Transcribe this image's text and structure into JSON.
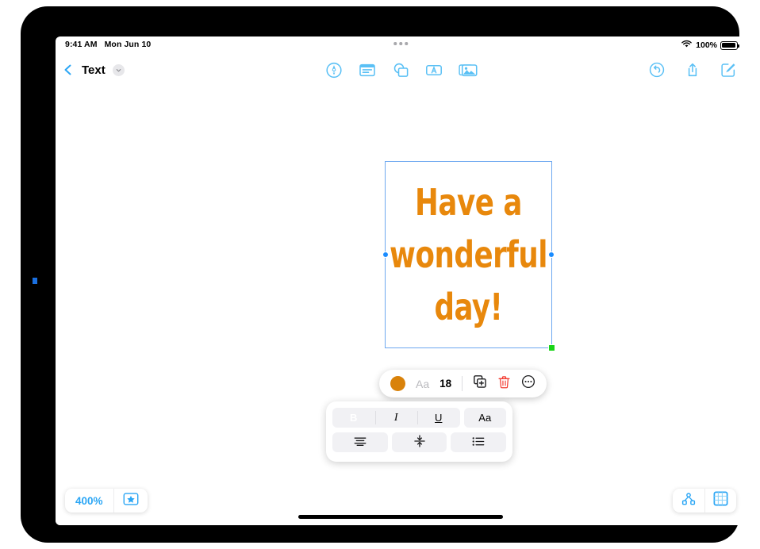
{
  "status_bar": {
    "time": "9:41 AM",
    "date": "Mon Jun 10",
    "battery_percent": "100%",
    "wifi_icon": "wifi-icon",
    "battery_icon": "battery-icon",
    "multitask_icon": "multitasking-dots-icon"
  },
  "nav_bar": {
    "back_icon": "chevron-left-icon",
    "document_title": "Text",
    "title_chevron_icon": "chevron-down-icon",
    "center_tools": [
      {
        "name": "markup-pen-tool",
        "icon": "pen-circle-icon"
      },
      {
        "name": "text-box-tool",
        "icon": "text-document-icon"
      },
      {
        "name": "shapes-tool",
        "icon": "overlapping-shapes-icon"
      },
      {
        "name": "insert-text-tool",
        "icon": "letter-a-box-icon"
      },
      {
        "name": "media-tool",
        "icon": "photo-stack-icon"
      }
    ],
    "right_tools": [
      {
        "name": "undo-button",
        "icon": "undo-circle-icon"
      },
      {
        "name": "share-button",
        "icon": "share-up-arrow-icon"
      },
      {
        "name": "compose-button",
        "icon": "compose-pencil-square-icon"
      }
    ]
  },
  "canvas": {
    "selected_text": {
      "lines": [
        "Have a",
        "wonderful",
        "day!"
      ],
      "color": "#e8880c",
      "selection_border_color": "#6ea8f0",
      "handle_color": "#1a8cff",
      "resize_handle_color": "#19d418"
    }
  },
  "context_toolbar": {
    "color_swatch": "#d9820a",
    "font_label": "Aa",
    "font_size": "18",
    "duplicate_icon": "duplicate-icon",
    "delete_icon": "trash-icon",
    "more_icon": "more-ellipsis-circle-icon"
  },
  "format_panel": {
    "row1": [
      {
        "label": "B",
        "name": "bold-button",
        "active": true
      },
      {
        "label": "I",
        "name": "italic-button",
        "active": false
      },
      {
        "label": "U",
        "name": "underline-button",
        "active": false
      },
      {
        "label": "Aa",
        "name": "font-style-button",
        "active": false
      }
    ],
    "row2": [
      {
        "name": "align-center-button",
        "icon": "align-center-icon"
      },
      {
        "name": "vertical-align-button",
        "icon": "vertical-align-center-icon"
      },
      {
        "name": "bullet-list-button",
        "icon": "bullet-list-icon"
      }
    ]
  },
  "bottom_bar": {
    "zoom_level": "400%",
    "favorite_icon": "star-box-icon",
    "nodes_icon": "hierarchy-nodes-icon",
    "grid_icon": "grid-square-icon",
    "home_indicator": "home-indicator"
  }
}
